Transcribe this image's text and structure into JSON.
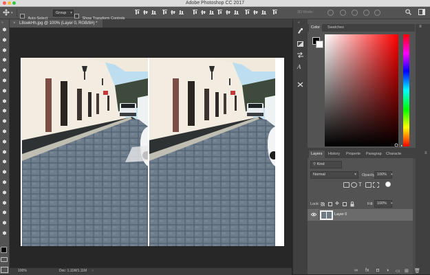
{
  "window": {
    "title": "Adobe Photoshop CC 2017",
    "traffic_colors": [
      "#fc5f57",
      "#fdbc2e",
      "#33c748"
    ]
  },
  "options_bar": {
    "auto_select_label": "Auto-Select:",
    "auto_select_value": "Group",
    "show_transform_label": "Show Transform Controls",
    "mode_3d_label": "3D Mode:"
  },
  "document": {
    "tab_title": "L8swkHh.jpg @ 100% (Layer 0, RGB/8#) *",
    "tab_close": "×",
    "zoom": "100%",
    "doc_size": "Doc: 1.11M/1.11M"
  },
  "color_panel": {
    "tabs": [
      "Color",
      "Swatches"
    ],
    "foreground": "#000000",
    "background": "#ffffff"
  },
  "layers_panel": {
    "tabs": [
      "Layers",
      "History",
      "Properte",
      "Paragrap",
      "Characte"
    ],
    "filter_value": "Kind",
    "blend_mode": "Normal",
    "opacity_label": "Opacity:",
    "opacity_value": "100%",
    "lock_label": "Lock:",
    "fill_label": "Fill:",
    "fill_value": "100%",
    "layers": [
      {
        "name": "Layer 0",
        "visible": true,
        "selected": true
      }
    ],
    "bottom_icons": [
      "link-icon",
      "fx-icon",
      "mask-icon",
      "adjustment-icon",
      "folder-icon",
      "new-layer-icon",
      "trash-icon"
    ],
    "bottom_glyphs": [
      "∞",
      "fx",
      "◘",
      "◑",
      "▭",
      "⊞",
      "🗑"
    ]
  },
  "colors": {
    "ui_dark": "#262626",
    "ui_mid": "#535353",
    "ui_panel_tab": "#404040",
    "layer_selected": "#6b6b6b",
    "accent": "#ffffff"
  }
}
